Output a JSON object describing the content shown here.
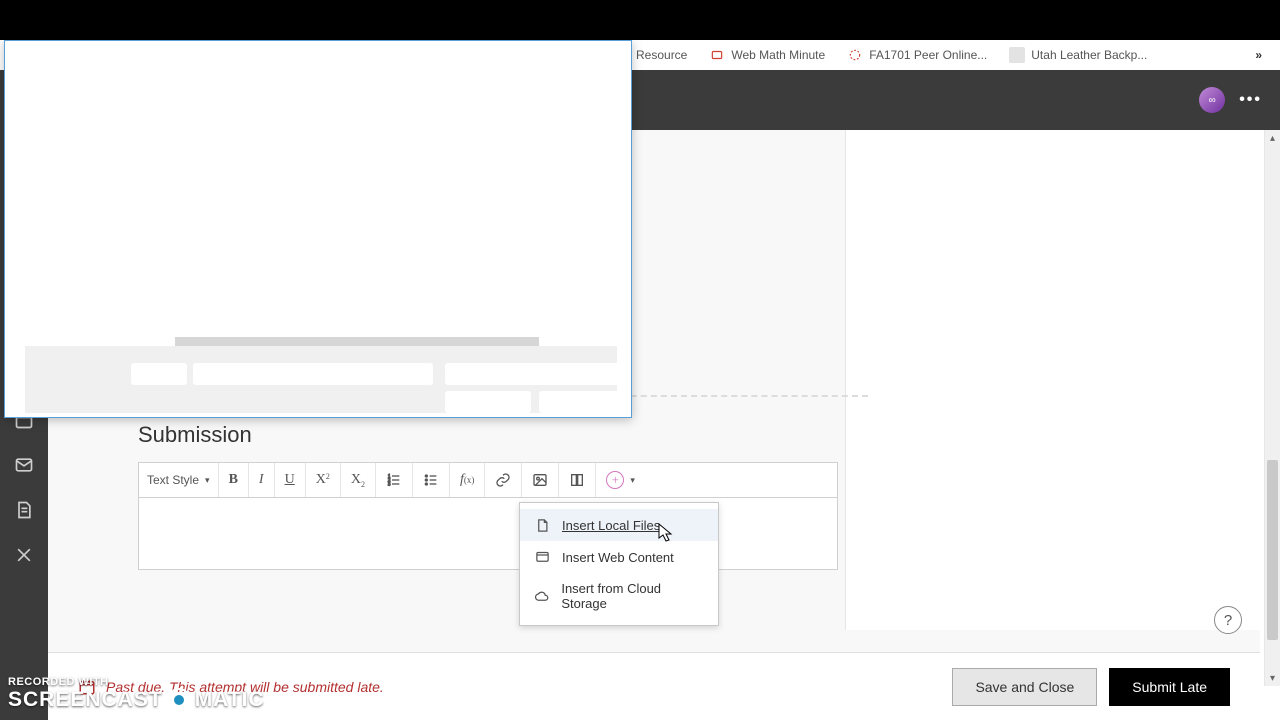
{
  "bookmarks": {
    "b0": "Resource",
    "b1": "Web Math Minute",
    "b2": "FA1701 Peer Online...",
    "b3": "Utah Leather Backp..."
  },
  "section": {
    "title": "Submission"
  },
  "toolbar": {
    "textstyle": "Text Style"
  },
  "dropdown": {
    "local": "Insert Local Files",
    "web": "Insert Web Content",
    "cloud": "Insert from Cloud Storage"
  },
  "footer": {
    "warning": "Past due. This attempt will be submitted late.",
    "save": "Save and Close",
    "submit": "Submit Late"
  },
  "watermark": {
    "rec": "RECORDED WITH",
    "a": "SCREENCAST",
    "b": "MATIC"
  }
}
